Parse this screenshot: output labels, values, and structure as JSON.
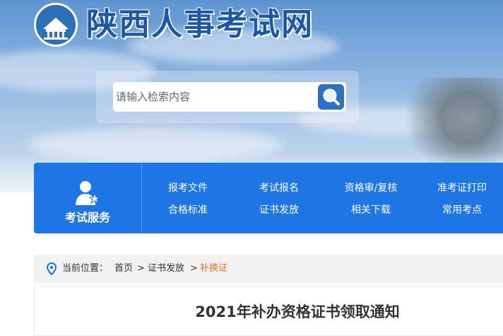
{
  "site": {
    "title": "陕西人事考试网"
  },
  "search": {
    "placeholder": "请输入检索内容"
  },
  "nav": {
    "service_label": "考试服务",
    "links": [
      {
        "label": "报考文件"
      },
      {
        "label": "考试报名"
      },
      {
        "label": "资格审/复核"
      },
      {
        "label": "准考证打印"
      },
      {
        "label": "合格标准"
      },
      {
        "label": "证书发放"
      },
      {
        "label": "相关下载"
      },
      {
        "label": "常用考点"
      }
    ]
  },
  "breadcrumb": {
    "prefix": "当前位置：",
    "items": [
      "首页",
      "证书发放",
      "补换证"
    ],
    "separator": ">"
  },
  "article": {
    "title": "2021年补办资格证书领取通知"
  },
  "colors": {
    "brand_blue": "#1d76e3",
    "title_blue": "#1c58a6",
    "current_crumb": "#e07020"
  },
  "icons": [
    "logo-emblem",
    "search-icon",
    "exam-service-icon",
    "location-pin-icon"
  ]
}
